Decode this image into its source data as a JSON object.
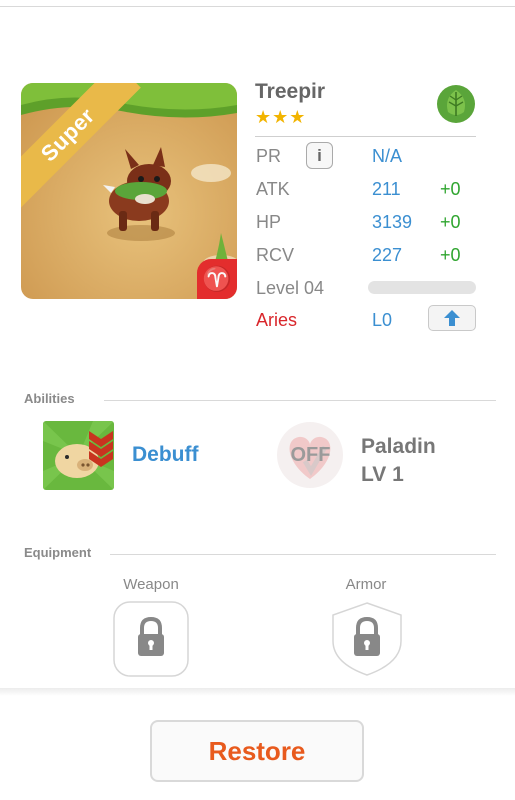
{
  "monster": {
    "name": "Treepir",
    "stars": "★★★",
    "rarity_label": "Super",
    "sign_glyph": "♈",
    "element_icon": "leaf-icon"
  },
  "stats": {
    "pr": {
      "label": "PR",
      "value": "N/A",
      "info_glyph": "i"
    },
    "atk": {
      "label": "ATK",
      "value": "211",
      "bonus": "+0"
    },
    "hp": {
      "label": "HP",
      "value": "3139",
      "bonus": "+0"
    },
    "rcv": {
      "label": "RCV",
      "value": "227",
      "bonus": "+0"
    },
    "level": {
      "label": "Level 04",
      "xp_fraction": 0.0
    },
    "sign": {
      "label": "Aries",
      "value": "L0",
      "upgrade_icon": "up-arrow-icon"
    }
  },
  "abilities": {
    "title": "Abilities",
    "primary": {
      "name": "Debuff",
      "icon": "pig-debuff-icon"
    },
    "class": {
      "state": "OFF",
      "name_line1": "Paladin",
      "name_line2": "LV 1"
    }
  },
  "equipment": {
    "title": "Equipment",
    "weapon": {
      "label": "Weapon",
      "icon": "lock-icon"
    },
    "armor": {
      "label": "Armor",
      "icon": "lock-icon"
    }
  },
  "actions": {
    "restore_label": "Restore"
  },
  "colors": {
    "accent_blue": "#3b8fd1",
    "bonus_green": "#2fa52f",
    "sign_red": "#d9262b",
    "restore_orange": "#e85a1d",
    "star_gold": "#f2b400",
    "ribbon_gold": "#e9b949"
  }
}
